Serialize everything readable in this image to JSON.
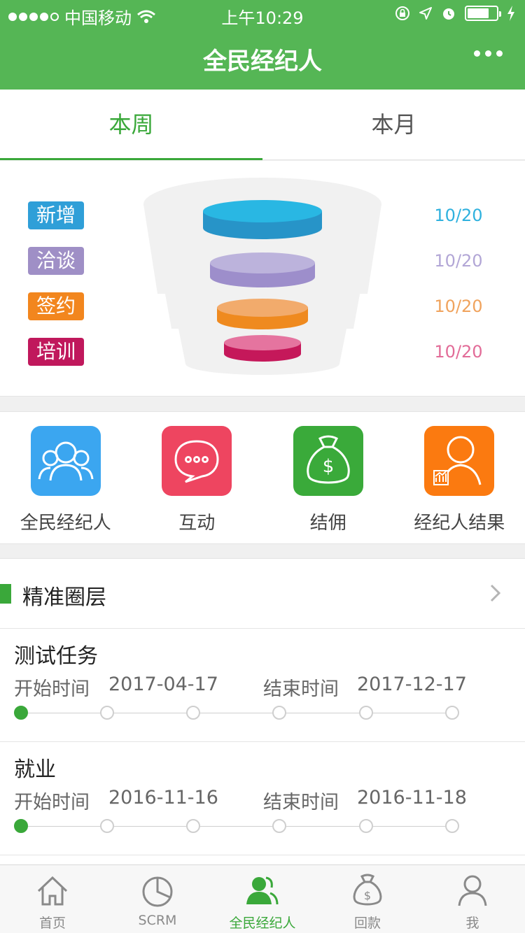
{
  "status": {
    "carrier": "中国移动",
    "time": "上午10:29"
  },
  "header": {
    "title": "全民经纪人"
  },
  "tabs": [
    {
      "label": "本周",
      "active": true
    },
    {
      "label": "本月",
      "active": false
    }
  ],
  "funnel": {
    "stages": [
      {
        "label": "新增",
        "value": "10/20",
        "color": "#2f9fd8",
        "value_color": "#2fb1de",
        "disc_color": "#29b7e3"
      },
      {
        "label": "洽谈",
        "value": "10/20",
        "color": "#9f8fc6",
        "value_color": "#b2a6d6",
        "disc_color": "#b9b1d9"
      },
      {
        "label": "签约",
        "value": "10/20",
        "color": "#f2861e",
        "value_color": "#f0a35d",
        "disc_color": "#f1a96d"
      },
      {
        "label": "培训",
        "value": "10/20",
        "color": "#c0185c",
        "value_color": "#e26c98",
        "disc_color": "#e16f9d"
      }
    ]
  },
  "quick": [
    {
      "label": "全民经纪人",
      "icon": "people-group-icon",
      "color": "#3ba6f0"
    },
    {
      "label": "互动",
      "icon": "chat-bubble-icon",
      "color": "#ee4560"
    },
    {
      "label": "结佣",
      "icon": "money-bag-icon",
      "color": "#3aaa3a"
    },
    {
      "label": "经纪人结果",
      "icon": "agent-chart-icon",
      "color": "#fb7a10"
    }
  ],
  "section": {
    "title": "精准圈层",
    "tasks": [
      {
        "title": "测试任务",
        "start_label": "开始时间",
        "start": "2017-04-17",
        "end_label": "结束时间",
        "end": "2017-12-17",
        "progress_step": 1,
        "steps_total": 6
      },
      {
        "title": "就业",
        "start_label": "开始时间",
        "start": "2016-11-16",
        "end_label": "结束时间",
        "end": "2016-11-18",
        "progress_step": 1,
        "steps_total": 6
      }
    ]
  },
  "tabbar": [
    {
      "label": "首页",
      "icon": "home-icon",
      "active": false
    },
    {
      "label": "SCRM",
      "icon": "pie-chart-icon",
      "active": false
    },
    {
      "label": "全民经纪人",
      "icon": "people-icon",
      "active": true
    },
    {
      "label": "回款",
      "icon": "money-bag-icon",
      "active": false
    },
    {
      "label": "我",
      "icon": "person-icon",
      "active": false
    }
  ],
  "colors": {
    "brand": "#55b655",
    "accent": "#3aa83a"
  }
}
